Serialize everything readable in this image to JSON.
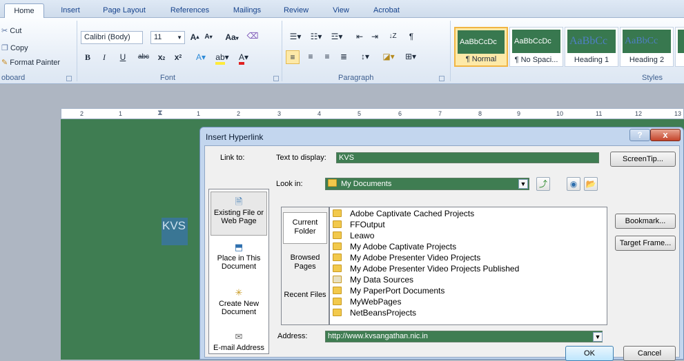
{
  "ribbon": {
    "tabs": [
      "Home",
      "Insert",
      "Page Layout",
      "References",
      "Mailings",
      "Review",
      "View",
      "Acrobat"
    ],
    "clipboard": {
      "cut": "Cut",
      "copy": "Copy",
      "format_painter": "Format Painter",
      "label": "oboard"
    },
    "font": {
      "name": "Calibri (Body)",
      "size": "11",
      "label": "Font"
    },
    "paragraph": {
      "label": "Paragraph"
    },
    "styles": {
      "label": "Styles",
      "items": [
        {
          "preview": "AaBbCcDc",
          "name": "¶ Normal"
        },
        {
          "preview": "AaBbCcDc",
          "name": "¶ No Spaci..."
        },
        {
          "preview": "AaBbCc",
          "name": "Heading 1"
        },
        {
          "preview": "AaBbCc",
          "name": "Heading 2"
        }
      ]
    }
  },
  "ruler": {
    "ticks": [
      "2",
      "1",
      "1",
      "2",
      "3",
      "4",
      "5",
      "6",
      "7",
      "8",
      "9",
      "10",
      "11",
      "12",
      "13"
    ]
  },
  "document": {
    "selected_text": "KVS"
  },
  "dialog": {
    "title": "Insert Hyperlink",
    "help": "?",
    "close": "x",
    "link_to_label": "Link to:",
    "text_to_display_label": "Text to display:",
    "text_to_display_value": "KVS",
    "screentip_button": "ScreenTip...",
    "look_in_label": "Look in:",
    "look_in_value": "My Documents",
    "link_to_items": [
      {
        "label": "Existing File or Web Page"
      },
      {
        "label": "Place in This Document"
      },
      {
        "label": "Create New Document"
      },
      {
        "label": "E-mail Address"
      }
    ],
    "nav_items": [
      {
        "label": "Current Folder"
      },
      {
        "label": "Browsed Pages"
      },
      {
        "label": "Recent Files"
      }
    ],
    "files": [
      "Adobe Captivate Cached Projects",
      "FFOutput",
      "Leawo",
      "My Adobe Captivate Projects",
      "My Adobe Presenter Video Projects",
      "My Adobe Presenter Video Projects Published",
      "My Data Sources",
      "My PaperPort Documents",
      "MyWebPages",
      "NetBeansProjects"
    ],
    "bookmark_button": "Bookmark...",
    "target_frame_button": "Target Frame...",
    "address_label": "Address:",
    "address_value": "http://www.kvsangathan.nic.in",
    "ok_button": "OK",
    "cancel_button": "Cancel"
  }
}
